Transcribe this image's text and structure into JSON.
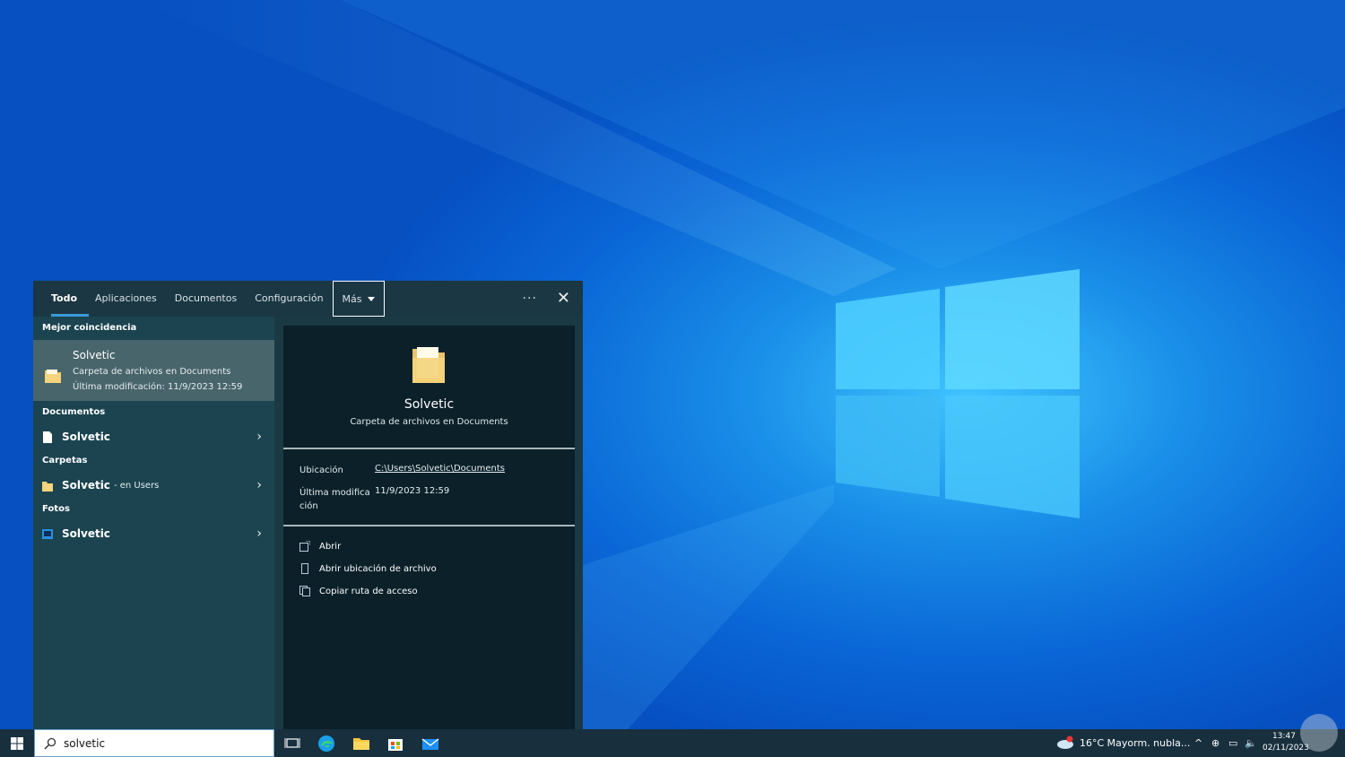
{
  "colors": {
    "accent": "#3a9ad9",
    "flyout_bg": "#1b3944",
    "preview_bg": "#0b2029",
    "selected_bg": "#49656c",
    "taskbar_bg": "#18303e"
  },
  "tabs": [
    {
      "label": "Todo"
    },
    {
      "label": "Aplicaciones"
    },
    {
      "label": "Documentos"
    },
    {
      "label": "Configuración"
    },
    {
      "label": "Más"
    }
  ],
  "tab_actions": {
    "more_icon": "ellipsis-icon",
    "close_icon": "close-icon"
  },
  "results": {
    "best_match_title": "Mejor coincidencia",
    "best_match": {
      "name": "Solvetic",
      "desc": "Carpeta de archivos en Documents",
      "modified": "Última modificación: 11/9/2023 12:59"
    },
    "documents_title": "Documentos",
    "documents_item": "Solvetic",
    "folders_title": "Carpetas",
    "folders_item": "Solvetic",
    "folders_item_sub": "- en Users",
    "photos_title": "Fotos",
    "photos_item": "Solvetic"
  },
  "preview": {
    "title": "Solvetic",
    "subtitle": "Carpeta de archivos en Documents",
    "location_label": "Ubicación",
    "location_value": "C:\\Users\\Solvetic\\Documents",
    "modified_label": "Última modifica ción",
    "modified_value": "11/9/2023 12:59",
    "actions": [
      "Abrir",
      "Abrir ubicación de archivo",
      "Copiar ruta de acceso"
    ]
  },
  "taskbar": {
    "search_value": "solvetic",
    "weather": "16°C  Mayorm. nubla...",
    "weather_badge": "1",
    "time": "13:47",
    "date": "02/11/2023"
  }
}
